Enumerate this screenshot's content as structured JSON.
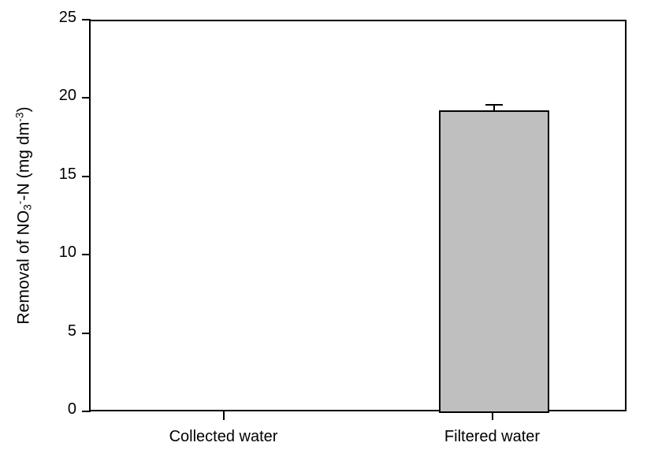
{
  "chart_data": {
    "type": "bar",
    "title": "",
    "subtitle": "",
    "xlabel": "",
    "ylabel": "Removal of NO3^- -N (mg dm^-3)",
    "ylabel_parts": {
      "prefix": "Removal of NO",
      "sub": "3",
      "sup_minus": "-",
      "mid": "-N (mg dm",
      "sup_exp": "-3",
      "suffix": ")"
    },
    "categories": [
      "Collected water",
      "Filtered water"
    ],
    "values": [
      0,
      19.3
    ],
    "errors": [
      0,
      0.4
    ],
    "error_type": "upper-only",
    "ylim": [
      0,
      25
    ],
    "yticks": [
      0,
      5,
      10,
      15,
      20,
      25
    ],
    "ytick_labels": [
      "0",
      "5",
      "10",
      "15",
      "20",
      "25"
    ],
    "grid": false,
    "legend": false,
    "legend_position": "none",
    "bar_fill_color": "#bfbfbf",
    "bar_edge_color": "#000000",
    "axis_color": "#000000",
    "background_color": "#ffffff",
    "frame": "full-box"
  }
}
